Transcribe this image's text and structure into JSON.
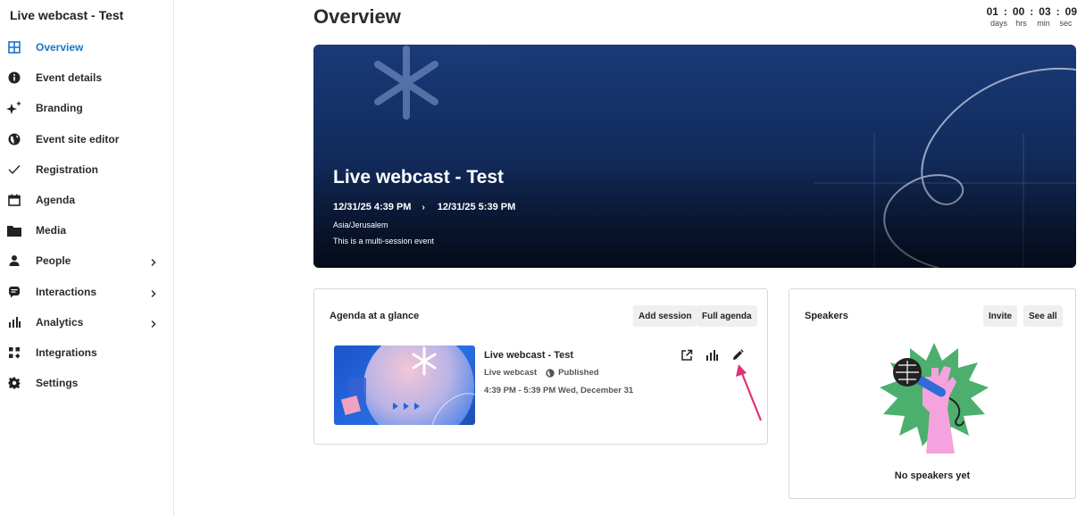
{
  "sidebar": {
    "title": "Live webcast - Test",
    "items": [
      {
        "label": "Overview",
        "icon": "grid-icon",
        "active": true
      },
      {
        "label": "Event details",
        "icon": "info-icon"
      },
      {
        "label": "Branding",
        "icon": "sparkle-icon"
      },
      {
        "label": "Event site editor",
        "icon": "globe-icon"
      },
      {
        "label": "Registration",
        "icon": "check-icon"
      },
      {
        "label": "Agenda",
        "icon": "calendar-icon"
      },
      {
        "label": "Media",
        "icon": "folder-icon"
      },
      {
        "label": "People",
        "icon": "person-icon",
        "has_submenu": true
      },
      {
        "label": "Interactions",
        "icon": "chat-icon",
        "has_submenu": true
      },
      {
        "label": "Analytics",
        "icon": "bar-chart-icon",
        "has_submenu": true
      },
      {
        "label": "Integrations",
        "icon": "integrations-icon"
      },
      {
        "label": "Settings",
        "icon": "gear-icon"
      }
    ]
  },
  "header": {
    "title": "Overview",
    "countdown": {
      "days": "01",
      "hours": "00",
      "minutes": "03",
      "seconds": "09",
      "separator": ":",
      "days_label": "days",
      "hours_label": "hrs",
      "minutes_label": "min",
      "seconds_label": "sec"
    }
  },
  "hero": {
    "title": "Live webcast - Test",
    "start": "12/31/25 4:39 PM",
    "arrow": "›",
    "end": "12/31/25 5:39 PM",
    "timezone": "Asia/Jerusalem",
    "subtitle": "This is a multi-session event"
  },
  "agenda": {
    "title": "Agenda at a glance",
    "add_session_label": "Add session",
    "full_agenda_label": "Full agenda",
    "session": {
      "title": "Live webcast - Test",
      "type": "Live webcast",
      "status": "Published",
      "time": "4:39 PM - 5:39 PM Wed, December 31"
    }
  },
  "speakers": {
    "title": "Speakers",
    "invite_label": "Invite",
    "see_all_label": "See all",
    "empty_text": "No speakers yet"
  },
  "colors": {
    "accent": "#1a73c9",
    "annotation_arrow": "#e0307a"
  }
}
